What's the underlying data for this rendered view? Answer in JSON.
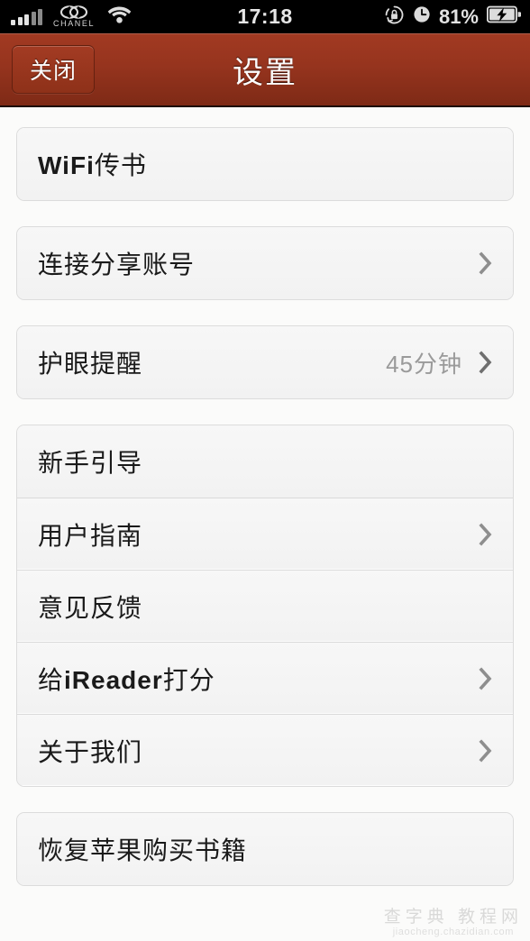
{
  "status_bar": {
    "signal_bars_total": 5,
    "signal_bars_active": 3,
    "carrier": "CHANEL",
    "wifi": "wifi-icon",
    "time": "17:18",
    "rotation_lock": "rotation-lock-icon",
    "alarm": "alarm-clock-icon",
    "battery_percent": "81%",
    "battery_state": "charging"
  },
  "nav_bar": {
    "close_label": "关闭",
    "title": "设置",
    "background_color": "#96341e"
  },
  "groups": [
    {
      "rows": [
        {
          "label": "WiFi",
          "label_bold": "WiFi",
          "label_rest": "传书",
          "value": "",
          "chevron": false
        }
      ]
    },
    {
      "rows": [
        {
          "label": "连接分享账号",
          "value": "",
          "chevron": true
        }
      ]
    },
    {
      "rows": [
        {
          "label": "护眼提醒",
          "value": "45分钟",
          "chevron": true
        }
      ]
    },
    {
      "rows": [
        {
          "label": "新手引导",
          "value": "",
          "chevron": false
        },
        {
          "label": "用户指南",
          "value": "",
          "chevron": true
        },
        {
          "label": "意见反馈",
          "value": "",
          "chevron": false
        },
        {
          "label": "给iReader打分",
          "label_pre": "给",
          "label_bold": "iReader",
          "label_rest": "打分",
          "value": "",
          "chevron": true
        },
        {
          "label": "关于我们",
          "value": "",
          "chevron": true
        }
      ]
    },
    {
      "rows": [
        {
          "label": "恢复苹果购买书籍",
          "value": "",
          "chevron": false
        }
      ]
    }
  ],
  "watermark": {
    "main": "查字典 教程网",
    "sub": "jiaocheng.chazidian.com"
  },
  "colors": {
    "nav_accent": "#96341e",
    "row_bg": "#f4f4f4",
    "page_bg": "#fbfbfa",
    "value_text": "#9a9a9a",
    "label_text": "#1a1a1a"
  }
}
